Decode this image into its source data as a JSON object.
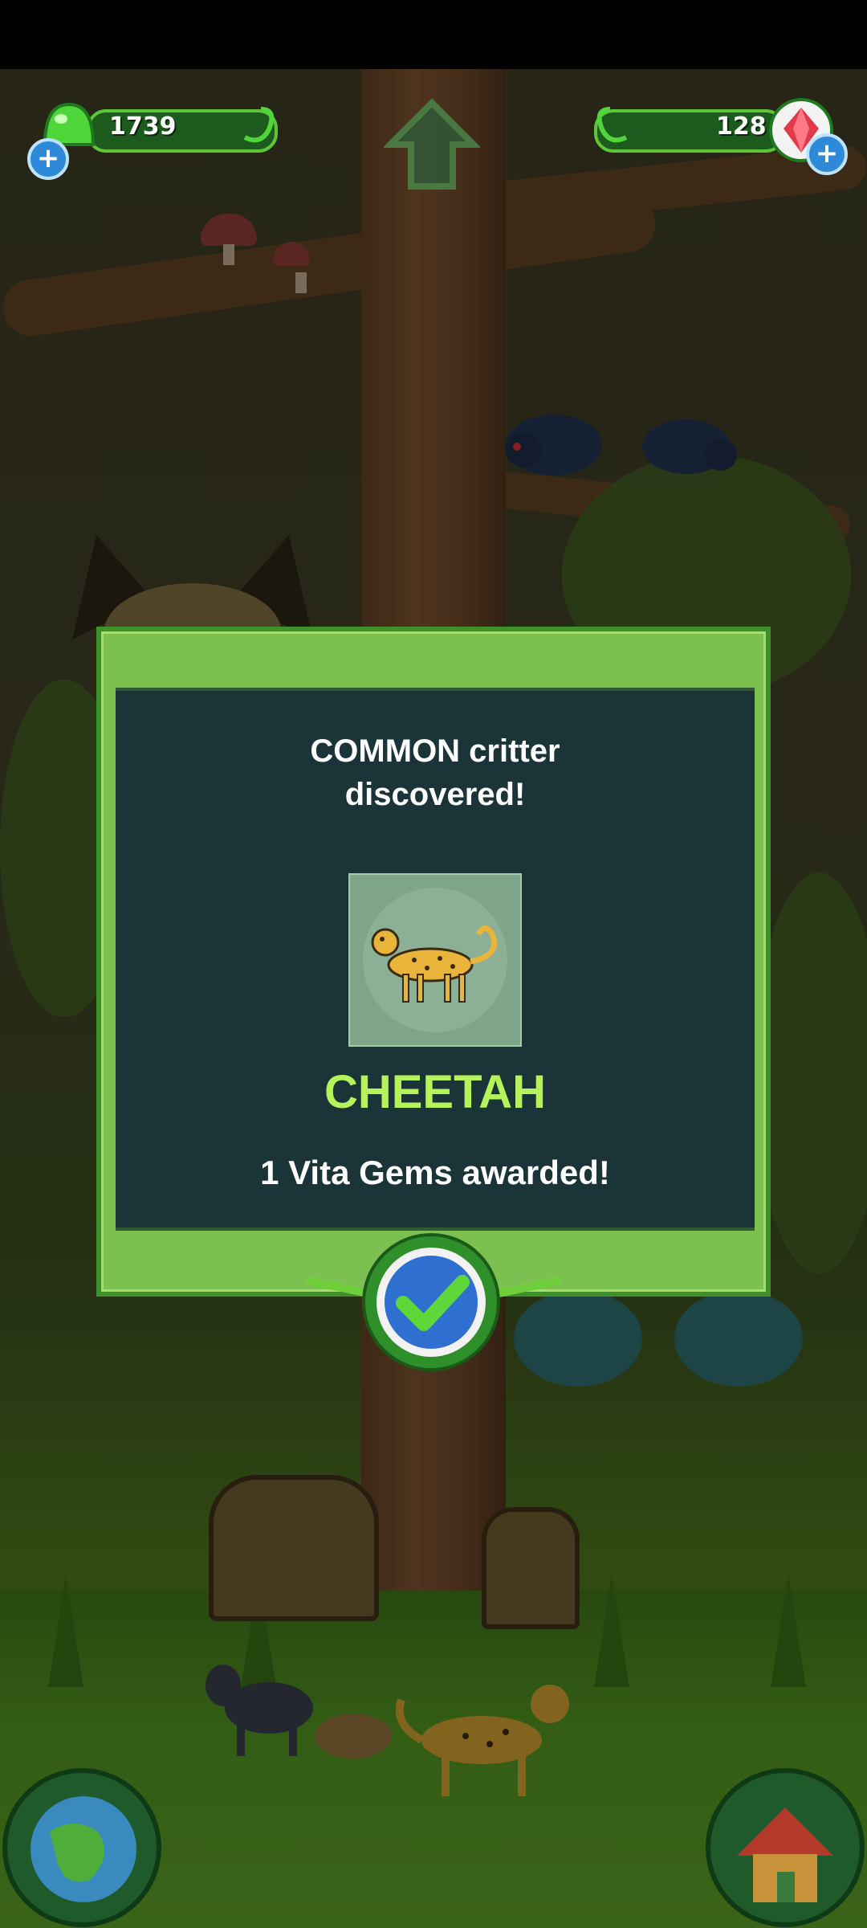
{
  "hud": {
    "green_currency": "1739",
    "gem_currency": "128"
  },
  "dialog": {
    "title_line1": "COMMON critter",
    "title_line2": "discovered!",
    "critter_name": "CHEETAH",
    "award": "1 Vita Gems awarded!"
  },
  "colors": {
    "dialog_frame": "#7bc050",
    "dialog_panel": "#1a3438",
    "critter_name": "#b6f35a"
  },
  "icons": {
    "left_currency": "green-gel-icon",
    "right_currency": "red-gem-icon",
    "confirm": "checkmark-icon",
    "world": "globe-icon",
    "home": "house-icon",
    "up": "up-arrow-icon"
  }
}
